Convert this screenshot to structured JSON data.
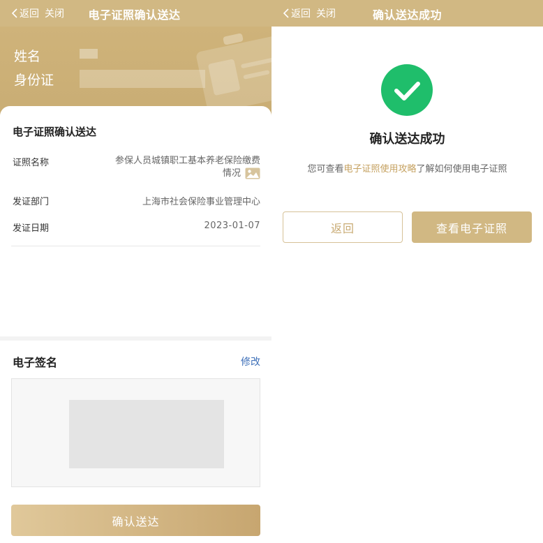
{
  "left": {
    "nav": {
      "back_label": "返回",
      "close_label": "关闭",
      "title": "电子证照确认送达"
    },
    "banner": {
      "name_label": "姓名",
      "id_label": "身份证"
    },
    "card": {
      "title": "电子证照确认送达",
      "rows": [
        {
          "label": "证照名称",
          "value": "参保人员城镇职工基本养老保险缴费情况"
        },
        {
          "label": "发证部门",
          "value": "上海市社会保险事业管理中心"
        },
        {
          "label": "发证日期",
          "value": "2023-01-07"
        }
      ]
    },
    "signature": {
      "title": "电子签名",
      "edit_label": "修改"
    },
    "confirm_label": "确认送达"
  },
  "right": {
    "nav": {
      "back_label": "返回",
      "close_label": "关闭",
      "title": "确认送达成功"
    },
    "success_title": "确认送达成功",
    "desc_prefix": "您可查看",
    "desc_link": "电子证照使用攻略",
    "desc_suffix": "了解如何使用电子证照",
    "back_button": "返回",
    "view_button": "查看电子证照"
  },
  "colors": {
    "brand_gold": "#d1b883",
    "success_green": "#1fbe6b",
    "link_blue": "#3d6fb8",
    "link_gold": "#c5a160"
  },
  "icons": [
    "chevron-left-icon",
    "image-icon",
    "checkmark-icon",
    "certificate-illustration"
  ]
}
